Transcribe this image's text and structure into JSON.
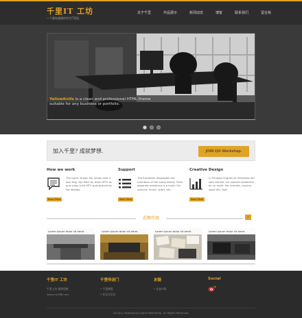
{
  "header": {
    "logo": "千里IT 工坊",
    "tagline": "一个富有激情的学生IT团队",
    "nav": [
      "关于千里",
      "作品展示",
      "新闻动态",
      "博客",
      "联系我们",
      "留言板"
    ]
  },
  "hero": {
    "caption_brand": "YellowKnife",
    "caption_text": " is a clean and professional HTML theme suitable for any business or portfolio.",
    "slides": 3,
    "active_slide": 1
  },
  "cta": {
    "text": "加入千里? 成就梦想.",
    "button": "JOIN Qili Workshop."
  },
  "features": [
    {
      "title": "How we work",
      "icon": "document-icon",
      "text": "The quick, brown fox jumps over a lazy dog. Djs flock by when MTV ax quiz prog. Junk MTV quiz graced by fox whelps.",
      "more": "Read More"
    },
    {
      "title": "Support",
      "icon": "list-icon",
      "text": "The European languages are members of the same family. Their separate existence is a myth. For science, music, sport, etc.",
      "more": "Read More"
    },
    {
      "title": "Creative Design",
      "icon": "bar-chart-icon",
      "text": "Li Europan lingues es membres del sam familie. Lor separat existentie es un myth. Por scientie, musica, sport etc, litot.",
      "more": "Read More"
    }
  ],
  "recent_works": {
    "title": "近期作品",
    "arrow": "›",
    "items": [
      {
        "caption": "Lorem ipsum dolor sit amet"
      },
      {
        "caption": "Lorem ipsum dolor sit amet"
      },
      {
        "caption": "Lorem ipsum dolor sit amet"
      },
      {
        "caption": "Lorem ipsum dolor sit amet"
      }
    ]
  },
  "footer": {
    "col1": {
      "title": "千里IT 工坊",
      "lines": [
        "千里工坊 做到您想",
        "www.moT88.com"
      ]
    },
    "col2": {
      "title": "千里传送门",
      "links": [
        "千里博客",
        "后台大后台"
      ]
    },
    "col3": {
      "title": "友链",
      "links": [
        "长安IT网"
      ]
    },
    "col4": {
      "title": "Social",
      "icon": "weibo-icon"
    },
    "copyright": "2013(C) Powered by Qianli WorkShop. All Rights Reserved."
  },
  "colors": {
    "accent": "#e0a326",
    "header_bg": "#2d2d2d",
    "band_bg": "#3a3a3a",
    "footer_bg": "#2b2b2b"
  }
}
